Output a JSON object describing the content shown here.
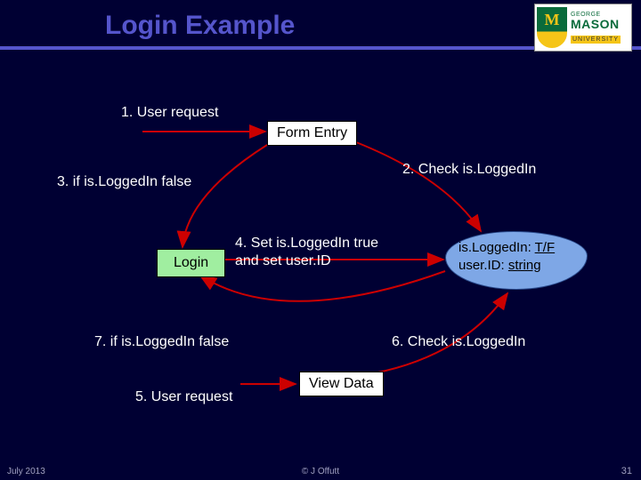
{
  "slide": {
    "title": "Login Example",
    "logo": {
      "line1": "GEORGE",
      "line2": "MASON",
      "line3": "UNIVERSITY"
    }
  },
  "labels": {
    "step1": "1. User request",
    "step2": "2. Check is.LoggedIn",
    "step3": "3. if is.LoggedIn false",
    "step4": "4. Set is.LoggedIn true and set user.ID",
    "step5": "5. User request",
    "step6": "6. Check is.LoggedIn",
    "step7": "7. if is.LoggedIn false"
  },
  "nodes": {
    "formEntry": "Form Entry",
    "login": "Login",
    "viewData": "View Data"
  },
  "state": {
    "line1_prefix": "is.LoggedIn: ",
    "line1_val": "T/F",
    "line2_prefix": "user.ID: ",
    "line2_val": "string"
  },
  "footer": {
    "date": "July 2013",
    "copyright": "© J  Offutt",
    "page": "31"
  }
}
